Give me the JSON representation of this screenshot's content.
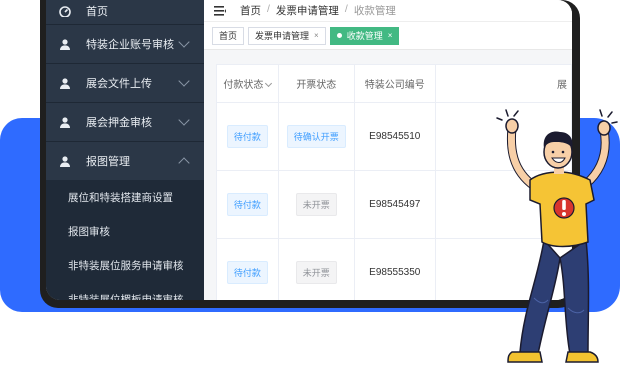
{
  "sidebar": {
    "items": [
      {
        "label": "首页",
        "icon": "dashboard-icon"
      },
      {
        "label": "特装企业账号审核",
        "icon": "user-icon"
      },
      {
        "label": "展会文件上传",
        "icon": "user-icon"
      },
      {
        "label": "展会押金审核",
        "icon": "user-icon"
      },
      {
        "label": "报图管理",
        "icon": "user-icon"
      }
    ],
    "submenu": [
      "展位和特装搭建商设置",
      "报图审核",
      "非特装展位服务申请审核",
      "非特装展位楣板申请审核"
    ]
  },
  "breadcrumb": {
    "home": "首页",
    "parent": "发票申请管理",
    "current": "收款管理",
    "sep": "/"
  },
  "tabs": [
    {
      "label": "首页",
      "closable": false,
      "active": false
    },
    {
      "label": "发票申请管理",
      "closable": true,
      "active": false
    },
    {
      "label": "收款管理",
      "closable": true,
      "active": true
    }
  ],
  "table": {
    "headers": [
      "付款状态",
      "开票状态",
      "特装公司编号",
      "展"
    ],
    "rows": [
      {
        "pay": "待付款",
        "invoice": "待确认开票",
        "invoice_style": "blue",
        "code": "E98545510"
      },
      {
        "pay": "待付款",
        "invoice": "未开票",
        "invoice_style": "gray",
        "code": "E98545497"
      },
      {
        "pay": "待付款",
        "invoice": "未开票",
        "invoice_style": "gray",
        "code": "E98555350"
      }
    ]
  },
  "colors": {
    "accent": "#2f6bff",
    "sidebar": "#2b3747",
    "active_tab": "#42b983"
  }
}
